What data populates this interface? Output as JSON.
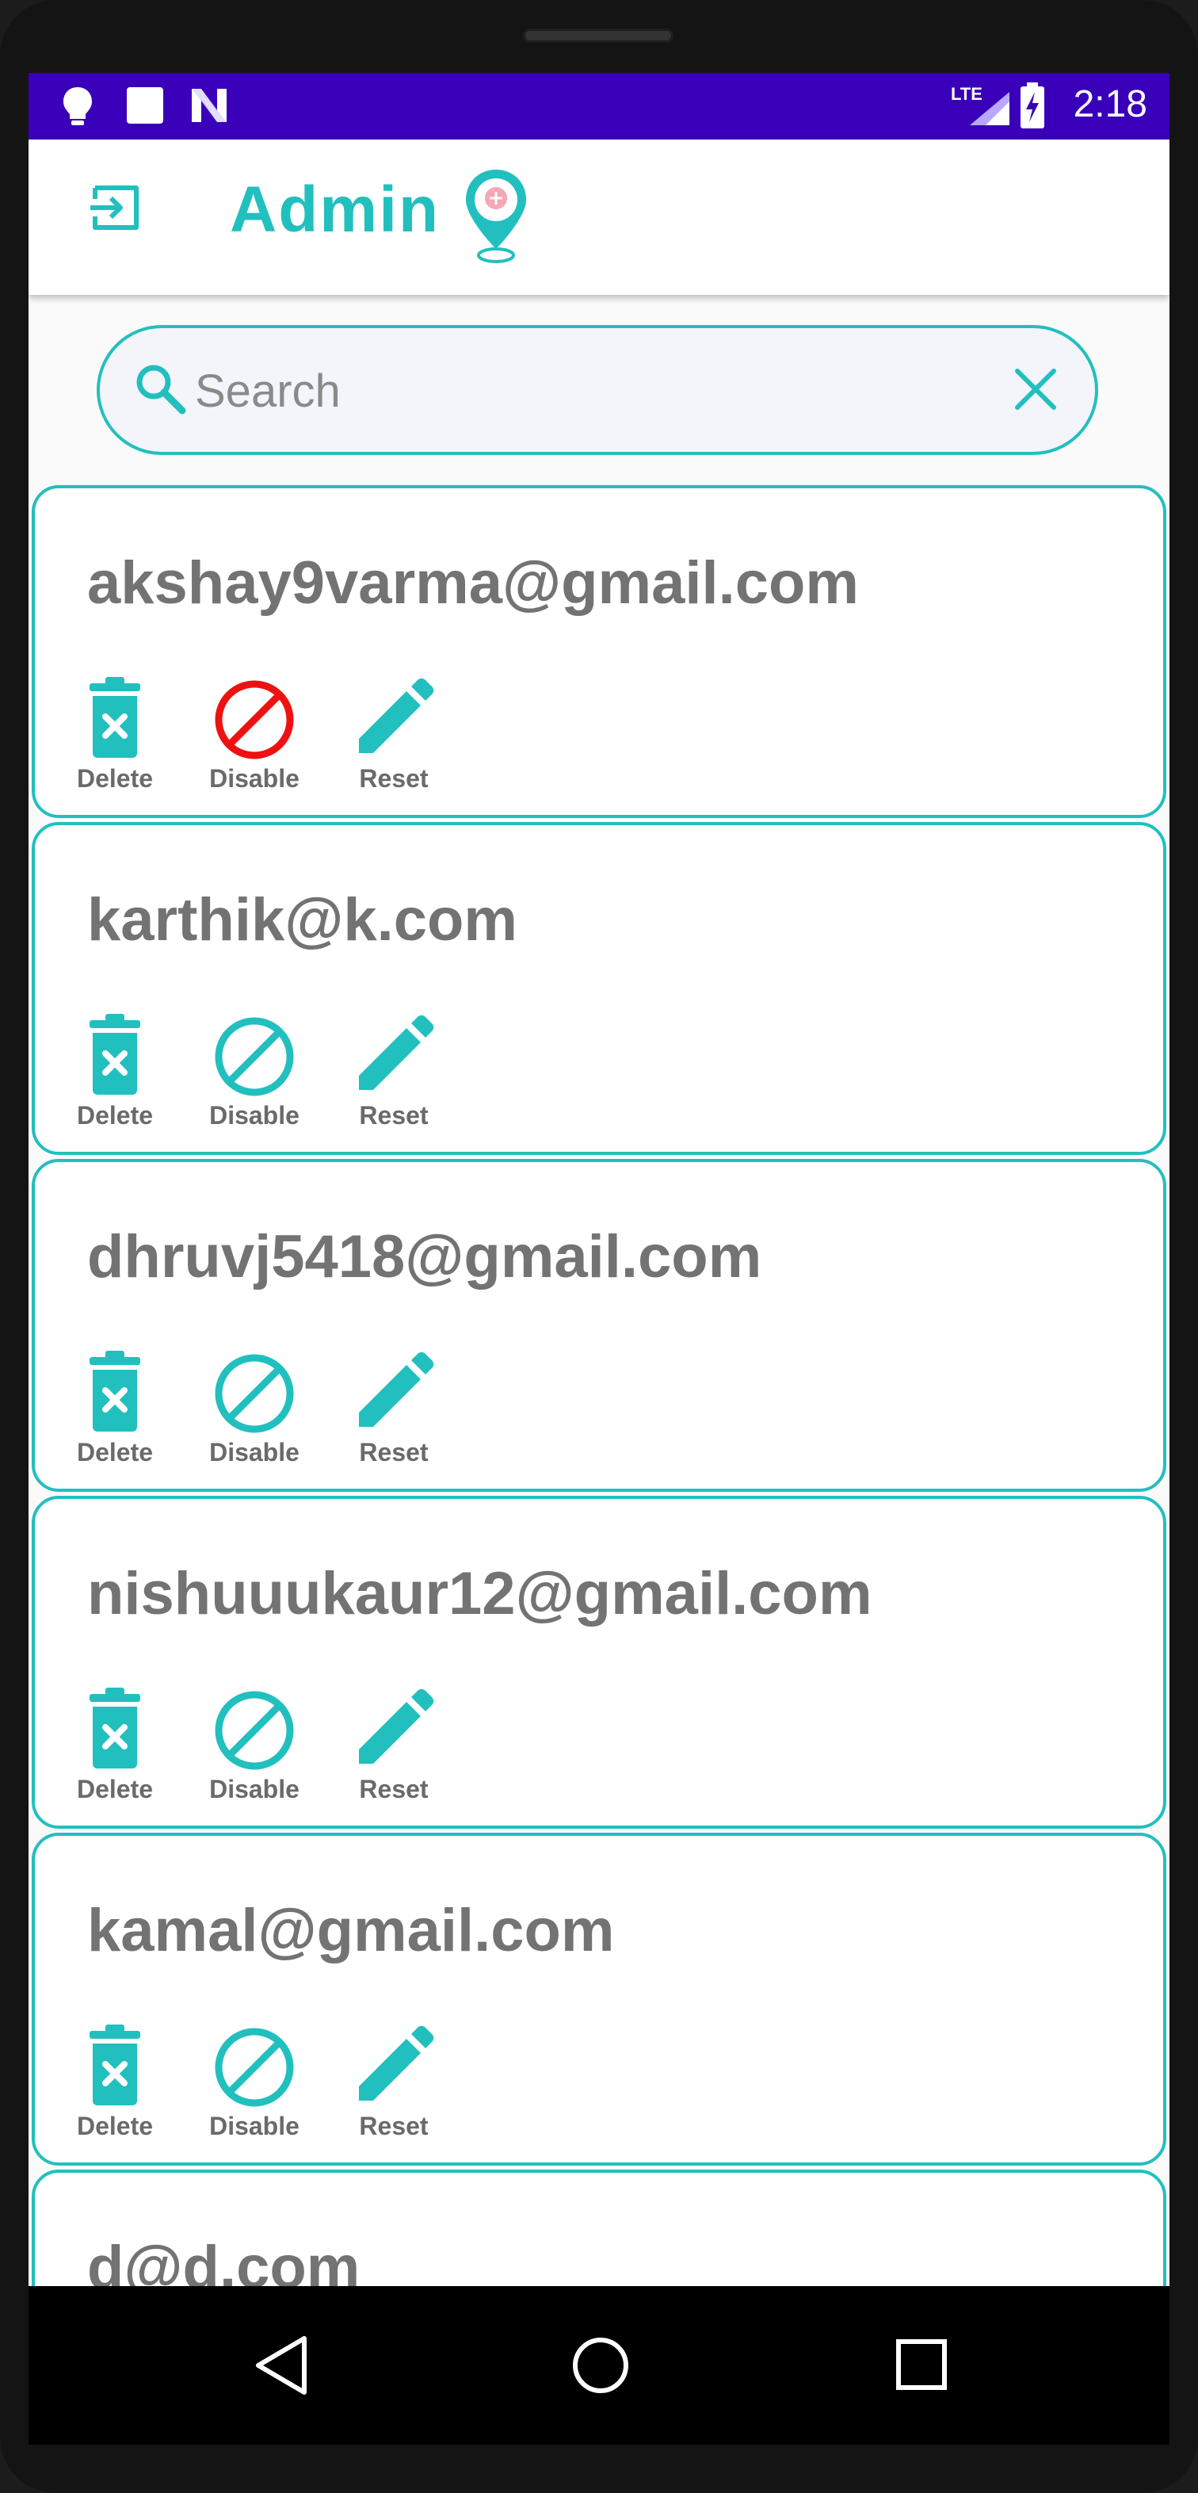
{
  "status_bar": {
    "time": "2:18",
    "network": "LTE",
    "left_icons": [
      "bulb-icon",
      "square-icon",
      "n-icon"
    ],
    "background": "#3a00b9"
  },
  "app_bar": {
    "title": "Admin",
    "logout_icon": "logout-icon",
    "logo_icon": "location-pin-icon"
  },
  "search": {
    "placeholder": "Search",
    "value": ""
  },
  "actions": {
    "delete_label": "Delete",
    "disable_label": "Disable",
    "reset_label": "Reset"
  },
  "users": [
    {
      "email": "akshay9varma@gmail.com",
      "disabled": true
    },
    {
      "email": "karthik@k.com",
      "disabled": false
    },
    {
      "email": "dhruvj5418@gmail.com",
      "disabled": false
    },
    {
      "email": "nishuuukaur12@gmail.com",
      "disabled": false
    },
    {
      "email": "kamal@gmail.com",
      "disabled": false
    },
    {
      "email": "d@d.com",
      "disabled": false
    }
  ],
  "colors": {
    "accent": "#22bfbf",
    "disabled_red": "#ee1111",
    "text_gray": "#737373"
  },
  "nav_bar": {
    "buttons": [
      "back-icon",
      "home-icon",
      "recents-icon"
    ]
  }
}
